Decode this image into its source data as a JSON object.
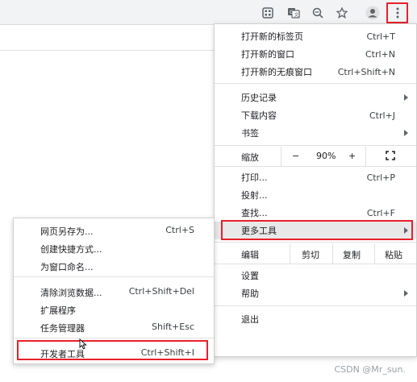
{
  "toolbar": {
    "icons": [
      "grid-icon",
      "translate-icon",
      "zoom-icon",
      "star-icon",
      "profile-icon",
      "more-vert-icon"
    ]
  },
  "main_menu": {
    "new_tab": {
      "label": "打开新的标签页",
      "shortcut": "Ctrl+T"
    },
    "new_window": {
      "label": "打开新的窗口",
      "shortcut": "Ctrl+N"
    },
    "new_incognito": {
      "label": "打开新的无痕窗口",
      "shortcut": "Ctrl+Shift+N"
    },
    "history": {
      "label": "历史记录"
    },
    "downloads": {
      "label": "下载内容",
      "shortcut": "Ctrl+J"
    },
    "bookmarks": {
      "label": "书签"
    },
    "zoom": {
      "label": "缩放",
      "minus": "−",
      "value": "90%",
      "plus": "+"
    },
    "print": {
      "label": "打印...",
      "shortcut": "Ctrl+P"
    },
    "cast": {
      "label": "投射..."
    },
    "find": {
      "label": "查找...",
      "shortcut": "Ctrl+F"
    },
    "more_tools": {
      "label": "更多工具"
    },
    "edit": {
      "label": "编辑",
      "cut": "剪切",
      "copy": "复制",
      "paste": "粘贴"
    },
    "settings": {
      "label": "设置"
    },
    "help": {
      "label": "帮助"
    },
    "exit": {
      "label": "退出"
    }
  },
  "sub_menu": {
    "save_page": {
      "label": "网页另存为...",
      "shortcut": "Ctrl+S"
    },
    "create_shortcut": {
      "label": "创建快捷方式..."
    },
    "name_window": {
      "label": "为窗口命名..."
    },
    "clear_data": {
      "label": "清除浏览数据...",
      "shortcut": "Ctrl+Shift+Del"
    },
    "extensions": {
      "label": "扩展程序"
    },
    "task_manager": {
      "label": "任务管理器",
      "shortcut": "Shift+Esc"
    },
    "dev_tools": {
      "label": "开发者工具",
      "shortcut": "Ctrl+Shift+I"
    }
  },
  "watermark": "CSDN @Mr_sun.",
  "colors": {
    "highlight": "#e8202a",
    "toolbar_bg": "#f1f3f4"
  }
}
